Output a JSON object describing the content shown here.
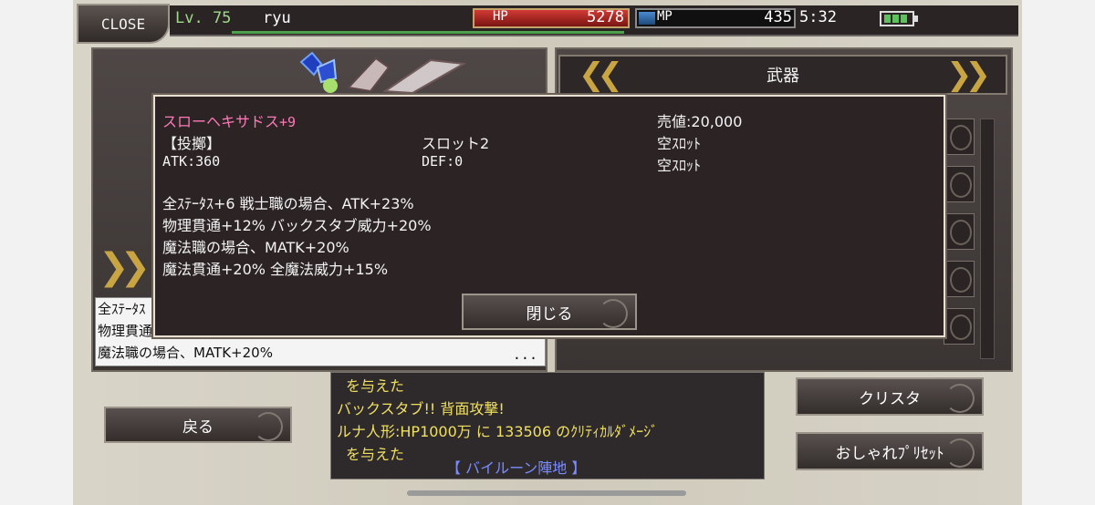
{
  "header": {
    "close_label": "CLOSE",
    "level": "Lv. 75",
    "player_name": "ryu",
    "hp_label": "HP",
    "hp_value": "5278",
    "mp_label": "MP",
    "mp_value": "435",
    "mp_fill_percent": 11,
    "time": "5:32",
    "battery_level": "3/4"
  },
  "equipment": {
    "category_title": "武器",
    "prev_icon": "double-chevron-left-icon",
    "next_icon": "double-chevron-right-icon",
    "left_lines": [
      "全ｽﾃｰﾀｽ",
      "物理貫通",
      "魔法職の場合、MATK+20%"
    ],
    "left_more": "..."
  },
  "dialog": {
    "item_name": "スローヘキサドス",
    "refine": "+9",
    "type": "【投擲】",
    "slot": "スロット2",
    "atk": "ATK:360",
    "def": "DEF:0",
    "price": "売値:20,000",
    "empty_slot_1": "空ｽﾛｯﾄ",
    "empty_slot_2": "空ｽﾛｯﾄ",
    "effects": [
      "全ｽﾃｰﾀｽ+6 戦士職の場合、ATK+23%",
      "物理貫通+12% バックスタブ威力+20%",
      "魔法職の場合、MATK+20%",
      "魔法貫通+20% 全魔法威力+15%"
    ],
    "close_label": "閉じる"
  },
  "buttons": {
    "back": "戻る",
    "crysta": "クリスタ",
    "fashion_preset": "おしゃれﾌﾟﾘｾｯﾄ"
  },
  "chat": {
    "lines": [
      "を与えた",
      "バックスタブ!! 背面攻撃!",
      "ルナ人形:HP1000万 に 133506 のｸﾘﾃｨｶﾙﾀﾞﾒｰｼﾞ",
      "を与えた"
    ],
    "location": "【 バイルーン陣地 】"
  }
}
